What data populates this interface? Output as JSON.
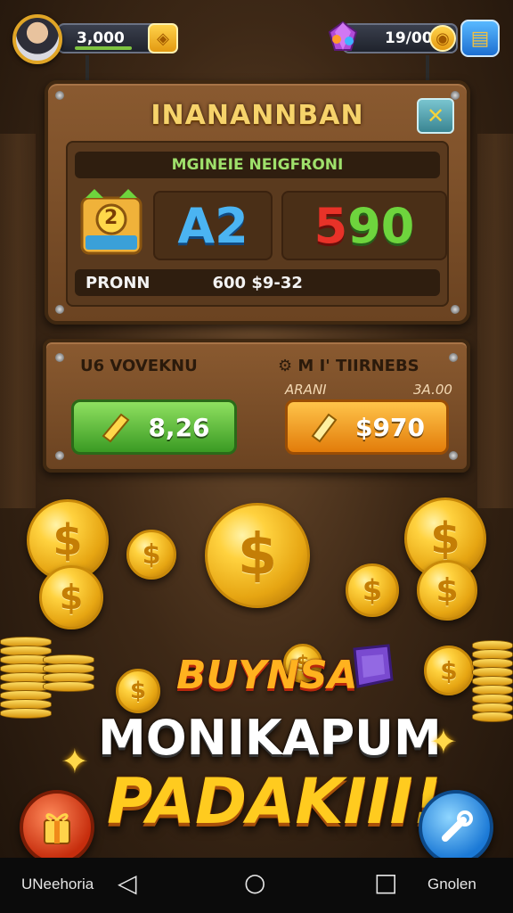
{
  "header": {
    "coins_value": "3,000",
    "gems_value": "19/00",
    "coin_icon_glyph": "◈",
    "coin_icon_glyph_right": "◉",
    "shop_glyph": "▤"
  },
  "panel": {
    "title": "INANANNBAN",
    "close_glyph": "✕",
    "subtitle": "MGINEIE NEIGFRONI",
    "badge_number": "2",
    "score_left": "A2",
    "score_right_red": "5",
    "score_right_green": "90",
    "footer_label": "PRONN",
    "footer_value": "600 $9-32"
  },
  "offers": {
    "left_label": "U6 VOVEKNU",
    "right_label": "⚙ M I' TIIRNEBS",
    "right_sub_left": "ARANI",
    "right_sub_right": "3A.00",
    "green_button": "8,26",
    "orange_button": "$970"
  },
  "promo": {
    "line1": "BUYNSA",
    "line2": "MONIKAPUM",
    "line3": "PADAKIII!"
  },
  "navbar": {
    "left_label": "UNeehoria",
    "right_label": "Gnolen",
    "back_glyph": "◁",
    "home_glyph": "○",
    "recents_glyph": "□"
  },
  "colors": {
    "accent_gold": "#f6d36b",
    "green_button": "#3a9a23",
    "orange_button": "#e27c0a",
    "score_blue": "#4bb4f2",
    "score_red": "#e83228",
    "score_green": "#6ed43d"
  },
  "icons": [
    "avatar",
    "coin-icon",
    "gem-icon",
    "shop-icon",
    "close-icon",
    "badge-icon",
    "coin-icon",
    "star-icon",
    "gift-icon",
    "wrench-icon"
  ]
}
